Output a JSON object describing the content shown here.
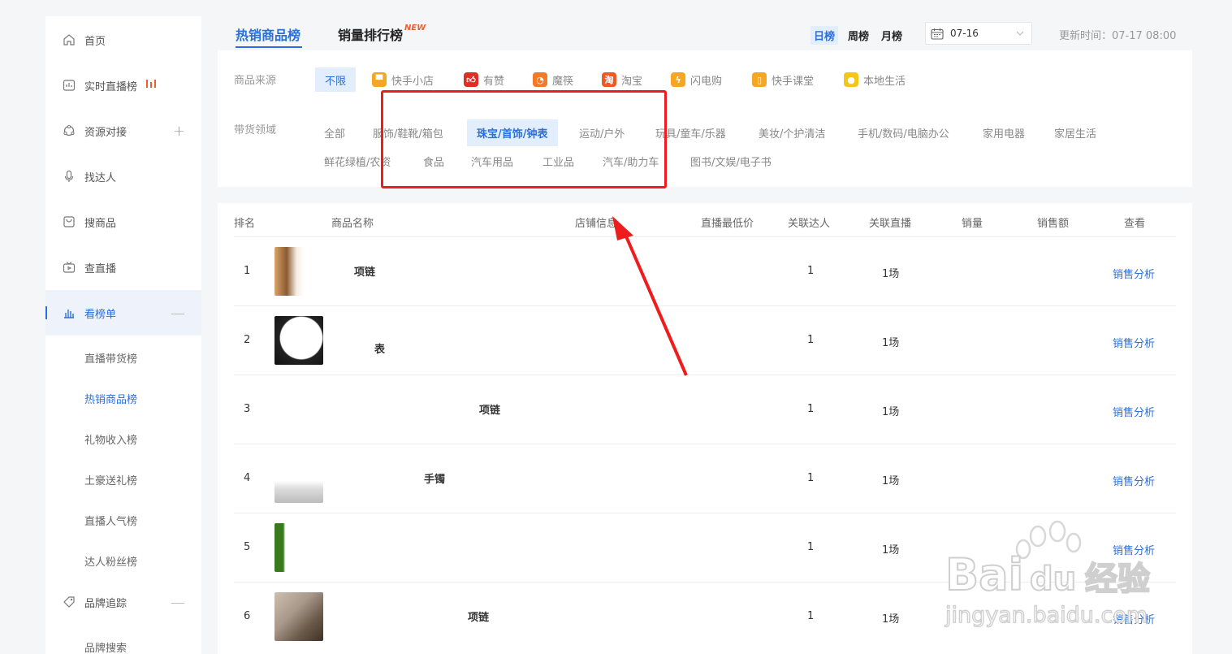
{
  "sidebar": {
    "items": [
      {
        "label": "首页",
        "icon": "home-icon"
      },
      {
        "label": "实时直播榜",
        "icon": "live-screen-icon"
      },
      {
        "label": "资源对接",
        "icon": "network-icon",
        "expander": "+"
      },
      {
        "label": "找达人",
        "icon": "microphone-icon"
      },
      {
        "label": "搜商品",
        "icon": "shopping-bag-icon"
      },
      {
        "label": "查直播",
        "icon": "tv-icon"
      },
      {
        "label": "看榜单",
        "icon": "bar-chart-icon",
        "expander": "—"
      },
      {
        "label": "品牌追踪",
        "icon": "tag-icon",
        "expander": "—"
      }
    ],
    "subitems": [
      "直播带货榜",
      "热销商品榜",
      "礼物收入榜",
      "土豪送礼榜",
      "直播人气榜",
      "达人粉丝榜"
    ],
    "brand_subitems": [
      "品牌搜索"
    ]
  },
  "tabs": {
    "hot": "热销商品榜",
    "sales": "销量排行榜",
    "new_badge": "NEW"
  },
  "periods": [
    "日榜",
    "周榜",
    "月榜"
  ],
  "date_value": "07-16",
  "update_time": "更新时间：07-17 08:00",
  "filter": {
    "source_label": "商品来源",
    "sources": [
      {
        "label": "不限",
        "active": true
      },
      {
        "label": "快手小店",
        "icon": "shop-icon",
        "color": "#f5a623"
      },
      {
        "label": "有赞",
        "icon": "thumbs-up-icon",
        "color": "#e02e24"
      },
      {
        "label": "魔筷",
        "icon": "mokuai-icon",
        "color": "#f07b2b"
      },
      {
        "label": "淘宝",
        "icon": "taobao-icon",
        "color": "#f05a22"
      },
      {
        "label": "闪电购",
        "icon": "lightning-bag-icon",
        "color": "#f5a623"
      },
      {
        "label": "快手课堂",
        "icon": "book-icon",
        "color": "#f5a623"
      },
      {
        "label": "本地生活",
        "icon": "location-icon",
        "color": "#f5c518"
      }
    ],
    "domain_label": "带货领域",
    "domains_row1": [
      "全部",
      "服饰/鞋靴/箱包",
      "珠宝/首饰/钟表",
      "运动/户外",
      "玩具/童车/乐器",
      "美妆/个护清洁",
      "手机/数码/电脑办公",
      "家用电器",
      "家居生活"
    ],
    "domains_row2": [
      "鲜花绿植/农资",
      "食品",
      "汽车用品",
      "工业品",
      "汽车/助力车",
      "图书/文娱/电子书"
    ],
    "active_domain": "珠宝/首饰/钟表"
  },
  "table": {
    "headers": [
      "排名",
      "商品名称",
      "店铺信息",
      "直播最低价",
      "关联达人",
      "关联直播",
      "销量",
      "销售额",
      "查看"
    ],
    "rows": [
      {
        "rank": "1",
        "name": "项链",
        "kol": "1",
        "live": "1场",
        "action": "销售分析"
      },
      {
        "rank": "2",
        "name": "表",
        "kol": "1",
        "live": "1场",
        "action": "销售分析"
      },
      {
        "rank": "3",
        "name": "项链",
        "kol": "1",
        "live": "1场",
        "action": "销售分析"
      },
      {
        "rank": "4",
        "name": "手镯",
        "kol": "1",
        "live": "1场",
        "action": "销售分析"
      },
      {
        "rank": "5",
        "name": "",
        "kol": "1",
        "live": "1场",
        "action": "销售分析"
      },
      {
        "rank": "6",
        "name": "项链",
        "kol": "1",
        "live": "1场",
        "action": "销售分析"
      }
    ]
  },
  "watermark": {
    "brand": "Bai du 经验",
    "url": "jingyan.baidu.com"
  },
  "colors": {
    "accent": "#2a6fdb",
    "annotation": "#ee1c1c",
    "new": "#e8612c"
  }
}
